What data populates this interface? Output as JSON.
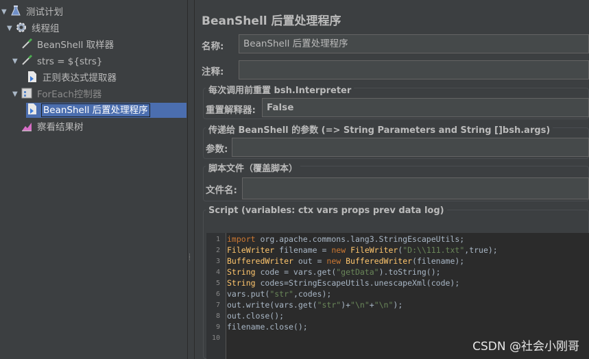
{
  "tree": {
    "nodes": [
      {
        "label": "测试计划",
        "icon": "flask-icon",
        "expanded": true
      },
      {
        "label": "线程组",
        "icon": "gear-icon",
        "expanded": true
      },
      {
        "label": "BeanShell 取样器",
        "icon": "pipette-icon"
      },
      {
        "label": "strs = ${strs}",
        "icon": "pipette-icon",
        "expanded": true
      },
      {
        "label": "正则表达式提取器",
        "icon": "extractor-icon"
      },
      {
        "label": "ForEach控制器",
        "icon": "controller-icon",
        "expanded": true,
        "disabled": true
      },
      {
        "label": "BeanShell 后置处理程序",
        "icon": "postprocessor-icon",
        "selected": true
      },
      {
        "label": "察看结果树",
        "icon": "chart-icon"
      }
    ]
  },
  "panel": {
    "title": "BeanShell 后置处理程序",
    "name_label": "名称:",
    "name_value": "BeanShell 后置处理程序",
    "comment_label": "注释:",
    "comment_value": "",
    "reset_group_title": "每次调用前重置 bsh.Interpreter",
    "reset_label": "重置解释器:",
    "reset_value": "False",
    "params_group_title": "传递给 BeanShell 的参数 (=> String Parameters and String []bsh.args)",
    "params_label": "参数:",
    "params_value": "",
    "file_group_title": "脚本文件（覆盖脚本）",
    "file_label": "文件名:",
    "file_value": "",
    "script_group_title": "Script (variables: ctx vars props prev data log)"
  },
  "script": {
    "line_numbers": [
      "1",
      "2",
      "3",
      "4",
      "5",
      "6",
      "7",
      "8",
      "9",
      "10"
    ],
    "lines": [
      "import org.apache.commons.lang3.StringEscapeUtils;",
      "FileWriter filename = new FileWriter(\"D:\\\\111.txt\",true);",
      "BufferedWriter out = new BufferedWriter(filename);",
      "String code = vars.get(\"getData\").toString();",
      "String codes=StringEscapeUtils.unescapeXml(code);",
      "vars.put(\"str\",codes);",
      "out.write(vars.get(\"str\")+\"\\n\"+\"\\n\");",
      "out.close();",
      "filename.close();",
      ""
    ]
  },
  "watermark": "CSDN @社会小刚哥",
  "colors": {
    "background": "#3c3f41",
    "selection": "#4b6eaf",
    "editor_bg": "#2b2b2b",
    "keyword": "#cc7832",
    "type": "#ffc66d",
    "string": "#6a8759"
  }
}
